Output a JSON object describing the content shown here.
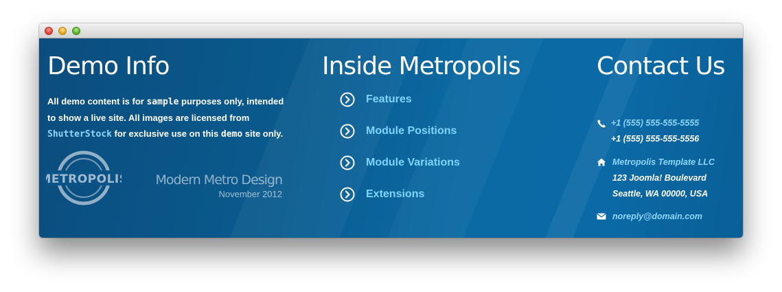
{
  "window": {
    "buttons": [
      "close",
      "minimize",
      "zoom"
    ]
  },
  "demo_info": {
    "title": "Demo Info",
    "text_part1": "All demo content is for ",
    "text_code1": "sample",
    "text_part2": " purposes only, intended to show a live site. All images are licensed from ",
    "text_link": "ShutterStock",
    "text_part3": " for exclusive use on this ",
    "text_code2": "demo",
    "text_part4": " site only.",
    "logo_text": "METROPOLIS",
    "tagline": "Modern Metro Design",
    "date": "November 2012"
  },
  "inside": {
    "title": "Inside Metropolis",
    "items": [
      {
        "label": "Features",
        "icon": "chevron-right-circle-icon"
      },
      {
        "label": "Module Positions",
        "icon": "chevron-right-circle-icon"
      },
      {
        "label": "Module Variations",
        "icon": "chevron-right-circle-icon"
      },
      {
        "label": "Extensions",
        "icon": "chevron-right-circle-icon"
      }
    ]
  },
  "contact": {
    "title": "Contact Us",
    "phone1": "+1 (555) 555-555-5555",
    "phone2": "+1 (555) 555-555-5556",
    "company": "Metropolis Template LLC",
    "address1": "123 Joomla! Boulevard",
    "address2": "Seattle, WA 00000, USA",
    "email": "noreply@domain.com"
  },
  "colors": {
    "background": "#0b5f95",
    "link": "#8fd6ff",
    "text": "#ffffff"
  }
}
